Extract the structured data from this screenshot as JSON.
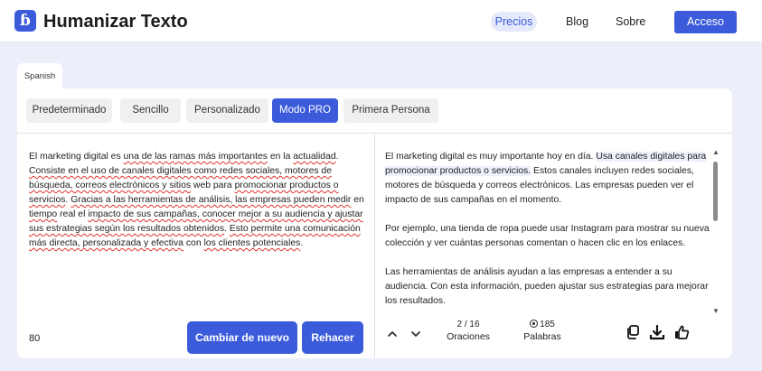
{
  "header": {
    "logo_glyph": "ɓ",
    "brand": "Humanizar Texto",
    "nav": {
      "precios": "Precios",
      "blog": "Blog",
      "sobre": "Sobre"
    },
    "login": "Acceso"
  },
  "language": "Spanish",
  "modes": [
    {
      "label": "Predeterminado",
      "active": false
    },
    {
      "label": "Sencillo",
      "active": false
    },
    {
      "label": "Personalizado",
      "active": false
    },
    {
      "label": "Modo PRO",
      "active": true
    },
    {
      "label": "Primera Persona",
      "active": false
    }
  ],
  "input": {
    "word_count": "80",
    "regenerate_label": "Cambiar de nuevo",
    "redo_label": "Rehacer",
    "segments": [
      {
        "t": "El marketing digital es ",
        "sp": false
      },
      {
        "t": "una de las ramas más importantes",
        "sp": true
      },
      {
        "t": " en la ",
        "sp": false
      },
      {
        "t": "actualidad",
        "sp": true
      },
      {
        "t": ". ",
        "sp": false
      },
      {
        "t": "Consiste en el uso de canales digitales como redes sociales, motores de búsqueda, correos electrónicos y sitios",
        "sp": true
      },
      {
        "t": " web para ",
        "sp": false
      },
      {
        "t": "promocionar productos o servicios",
        "sp": true
      },
      {
        "t": ". ",
        "sp": false
      },
      {
        "t": "Gracias a las herramientas de análisis, las empresas pueden medir",
        "sp": true
      },
      {
        "t": " en ",
        "sp": false
      },
      {
        "t": "tiempo",
        "sp": true
      },
      {
        "t": " real el ",
        "sp": false
      },
      {
        "t": "impacto de sus campañas, conocer mejor a su audiencia y ajustar sus estrategias según los resultados obtenidos",
        "sp": true
      },
      {
        "t": ". ",
        "sp": false
      },
      {
        "t": "Esto permite una comunicación más directa, personalizada y efectiva",
        "sp": true
      },
      {
        "t": " con ",
        "sp": false
      },
      {
        "t": "los clientes potenciales",
        "sp": true
      },
      {
        "t": ".",
        "sp": false
      }
    ]
  },
  "output": {
    "p1_start": "El marketing digital es muy importante hoy en día. ",
    "p1_highlight": "Usa canales digitales para promocionar productos o servicios.",
    "p1_end": " Estos canales incluyen redes sociales, motores de búsqueda y correos electrónicos. Las empresas pueden ver el impacto de sus campañas en el momento.",
    "p2": "Por ejemplo, una tienda de ropa puede usar Instagram para mostrar su nueva colección y ver cuántas personas comentan o hacen clic en los enlaces.",
    "p3": "Las herramientas de análisis ayudan a las empresas a entender a su audiencia. Con esta información, pueden ajustar sus estrategias para mejorar los resultados."
  },
  "stats": {
    "sentences_value": "2 / 16",
    "sentences_label": "Oraciones",
    "words_value": "185",
    "words_label": "Palabras"
  },
  "colors": {
    "accent": "#3b5bdb",
    "background": "#eceef9",
    "spell_underline": "#e03131"
  }
}
